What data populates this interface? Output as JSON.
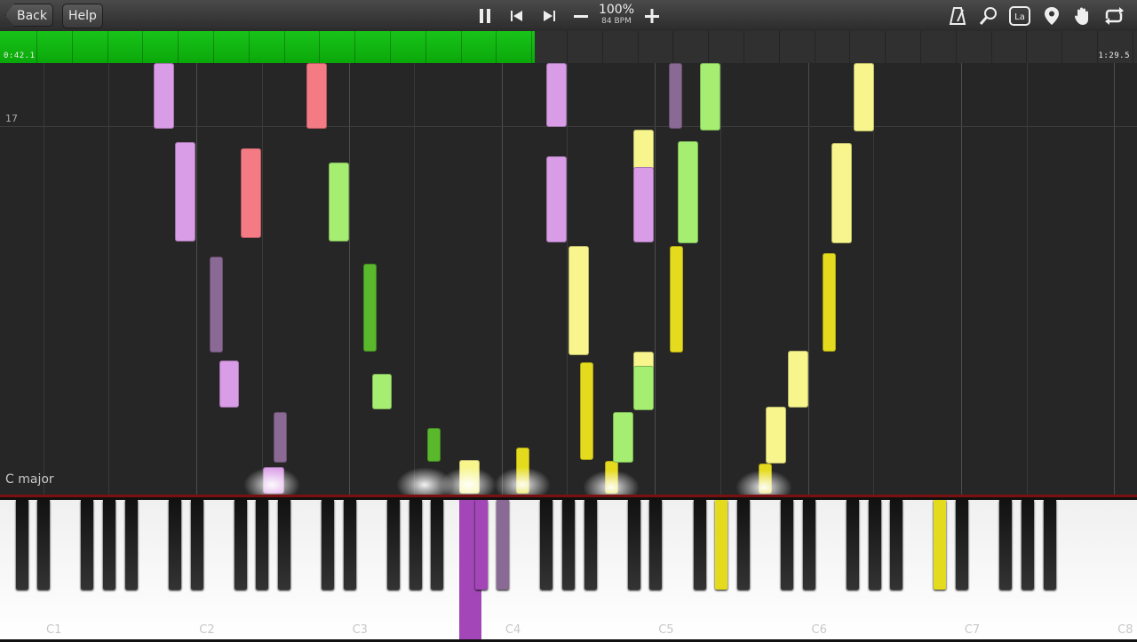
{
  "toolbar": {
    "back_label": "Back",
    "help_label": "Help",
    "zoom_percent": "100%",
    "tempo": "84 BPM"
  },
  "progress": {
    "elapsed": "0:42.1",
    "total": "1:29.5",
    "fraction": 0.47
  },
  "roll": {
    "measure_number": "17",
    "key_signature": "C major"
  },
  "keyboard": {
    "octave_labels": [
      "C1",
      "C2",
      "C3",
      "C4",
      "C5",
      "C6",
      "C7",
      "C8"
    ]
  },
  "colors": {
    "progress_green": "#19c319",
    "note_pink": "#d99ce6",
    "note_red": "#f47a84",
    "note_purple": "#8a6a95",
    "note_green": "#a6ee72",
    "note_dark_green": "#5ab82c",
    "note_yellow": "#f7f58c",
    "note_dark_yellow": "#e5db1e",
    "pressed_purple": "#a347b8"
  }
}
